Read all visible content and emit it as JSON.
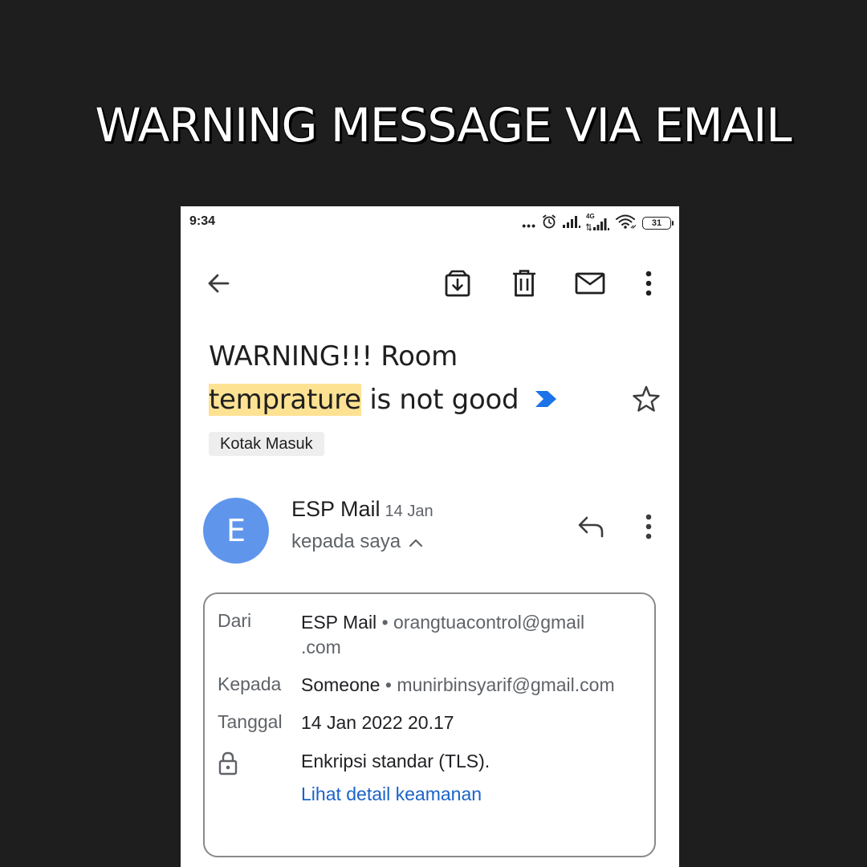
{
  "headline": "WARNING MESSAGE VIA EMAIL",
  "status_bar": {
    "time": "9:34",
    "network_label": "4G",
    "battery": "31"
  },
  "icons": {
    "back": "arrow-back-icon",
    "archive": "archive-icon",
    "delete": "trash-icon",
    "mark_unread": "mail-icon",
    "more": "more-vertical-icon",
    "star": "star-outline-icon",
    "importance": "importance-marker-icon",
    "reply": "reply-icon",
    "expand": "chevron-up-icon",
    "lock": "lock-icon"
  },
  "email": {
    "subject_line1": "WARNING!!! Room",
    "subject_highlight": "temprature",
    "subject_rest": "is not good",
    "label": "Kotak Masuk",
    "avatar_letter": "E",
    "sender": "ESP Mail",
    "date": "14 Jan",
    "recipient_summary": "kepada saya"
  },
  "details": {
    "from_label": "Dari",
    "from_name": "ESP Mail",
    "from_email_part1": "orangtuacontrol@gmail",
    "from_email_part2": ".com",
    "to_label": "Kepada",
    "to_name": "Someone",
    "to_email": "munirbinsyarif@gmail.com",
    "date_label": "Tanggal",
    "date_value": "14 Jan 2022 20.17",
    "encryption": "Enkripsi standar (TLS).",
    "security_link": "Lihat detail keamanan"
  },
  "colors": {
    "page_background": "#1e1e1e",
    "highlight": "#fde293",
    "avatar": "#5f96ec",
    "importance_marker": "#1a73e8",
    "link": "#1a63c9"
  }
}
